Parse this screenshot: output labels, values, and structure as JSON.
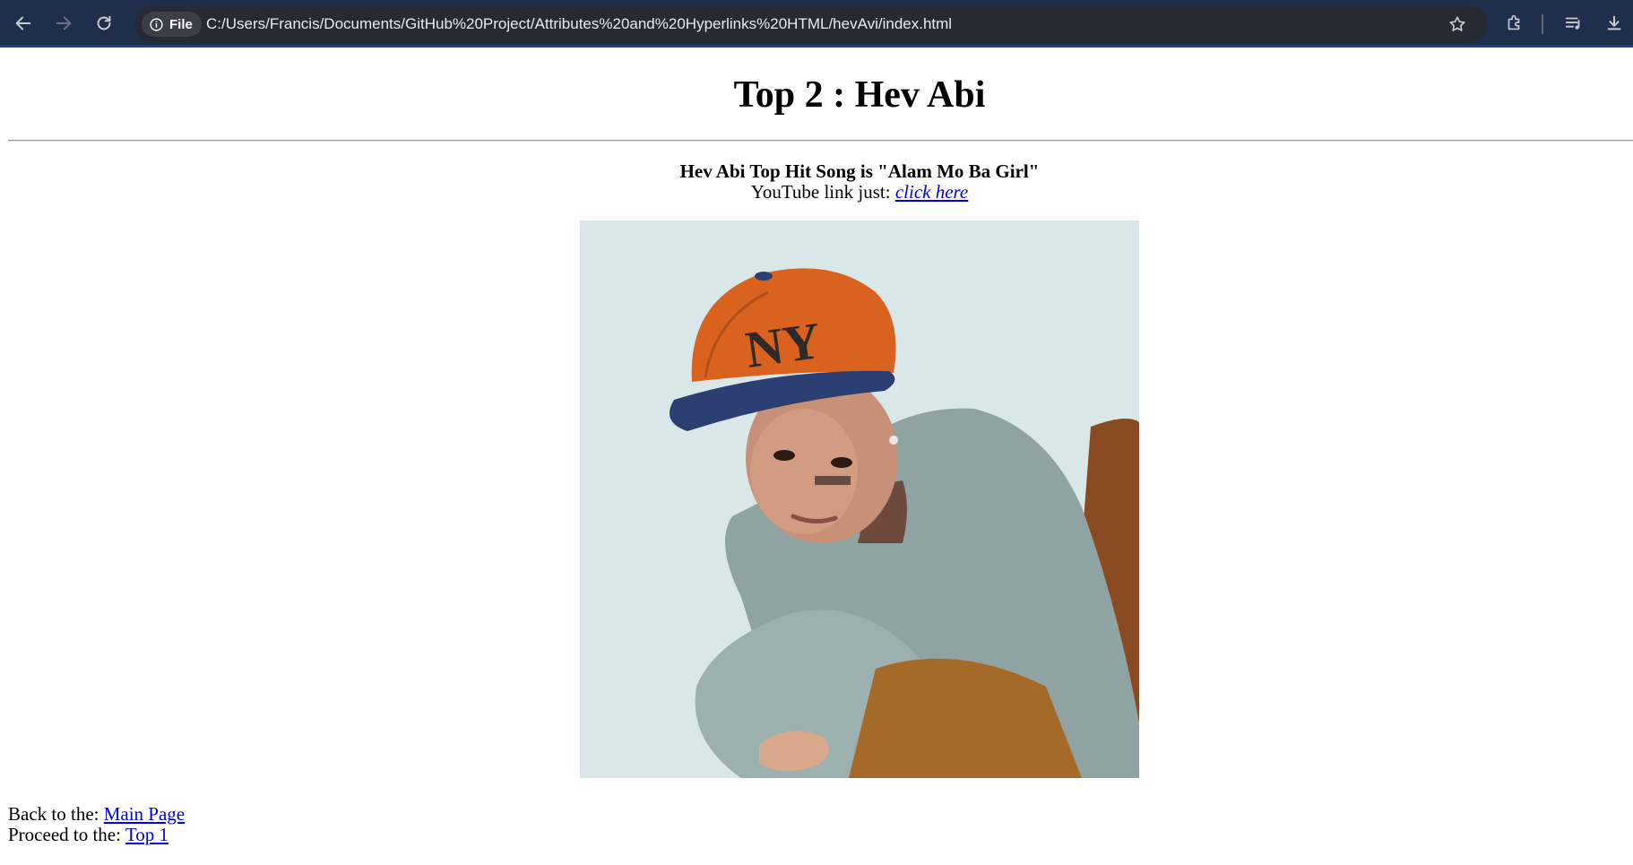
{
  "browser": {
    "chip_label": "File",
    "url": "C:/Users/Francis/Documents/GitHub%20Project/Attributes%20and%20Hyperlinks%20HTML/hevAvi/index.html",
    "icons": [
      "back-arrow-icon",
      "forward-arrow-icon",
      "reload-icon",
      "info-icon",
      "star-icon",
      "extensions-icon",
      "media-controls-icon",
      "download-icon"
    ]
  },
  "page": {
    "title": "Top 2 : Hev Abi",
    "song_line": "Hev Abi Top Hit Song is \"Alam Mo Ba Girl\"",
    "youtube_prefix": "YouTube link just: ",
    "youtube_link_text": "click here",
    "photo": {
      "subject": "person in orange NY cap and grey sweater"
    },
    "back_prefix": "Back to the: ",
    "back_link_text": "Main Page",
    "proceed_prefix": "Proceed to the: ",
    "proceed_link_text": "Top 1"
  },
  "colors": {
    "toolbar_bg": "#1f2e4b",
    "omnibox_bg": "#262a33",
    "link": "#0000ee",
    "cap_orange": "#d9621f",
    "cap_brim": "#2c3f73",
    "sweater": "#8fa3a3",
    "photo_bg": "#dfeced"
  }
}
